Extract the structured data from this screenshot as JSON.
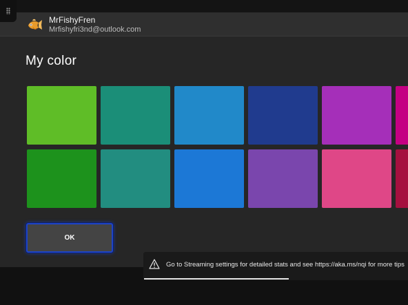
{
  "account": {
    "gamertag": "MrFishyFren",
    "email": "Mrfishyfri3nd@outlook.com",
    "avatar_icon": "goldfish-avatar"
  },
  "page": {
    "title": "My color"
  },
  "colors": {
    "row1": [
      "#5fbd27",
      "#1b8e78",
      "#2189c9",
      "#203b8e",
      "#a52fb9",
      "#c40083"
    ],
    "row2": [
      "#1d921c",
      "#228d80",
      "#1c78d6",
      "#7a46ad",
      "#df4787",
      "#a5103f"
    ],
    "selected_index": null
  },
  "ok_button": {
    "label": "OK"
  },
  "toast": {
    "icon": "warning-icon",
    "message": "Go to Streaming settings for detailed stats and see https://aka.ms/nqi for more tips",
    "progress_fraction": 0.55
  }
}
